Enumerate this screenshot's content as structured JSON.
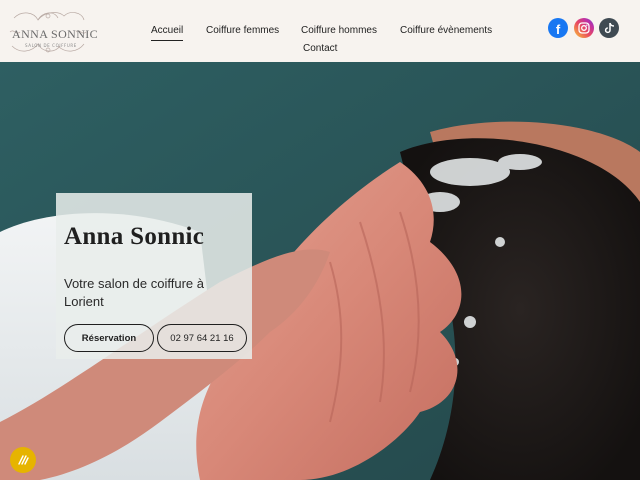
{
  "logo": {
    "title": "ANNA SONNIC",
    "subtitle": "SALON DE COIFFURE"
  },
  "nav": {
    "items": [
      {
        "label": "Accueil",
        "active": true
      },
      {
        "label": "Coiffure femmes"
      },
      {
        "label": "Coiffure hommes"
      },
      {
        "label": "Coiffure évènements"
      },
      {
        "label": "Contact"
      }
    ]
  },
  "social": [
    {
      "icon": "facebook-icon",
      "color": "#1877f2"
    },
    {
      "icon": "instagram-icon",
      "color": "#e94a5e"
    },
    {
      "icon": "tiktok-icon",
      "color": "#3f4a52"
    }
  ],
  "hero": {
    "title": "Anna Sonnic",
    "subtitle": "Votre salon de coiffure à Lorient",
    "buttons": {
      "reservation": "Réservation",
      "phone": "02 97 64 21 16"
    }
  },
  "accessibility": {
    "icon": "accessibility-icon",
    "color": "#e6b400"
  },
  "colors": {
    "header_bg": "#f7f3ef",
    "hero_teal": "#2f5d60",
    "card_bg": "#e9eeeb"
  }
}
